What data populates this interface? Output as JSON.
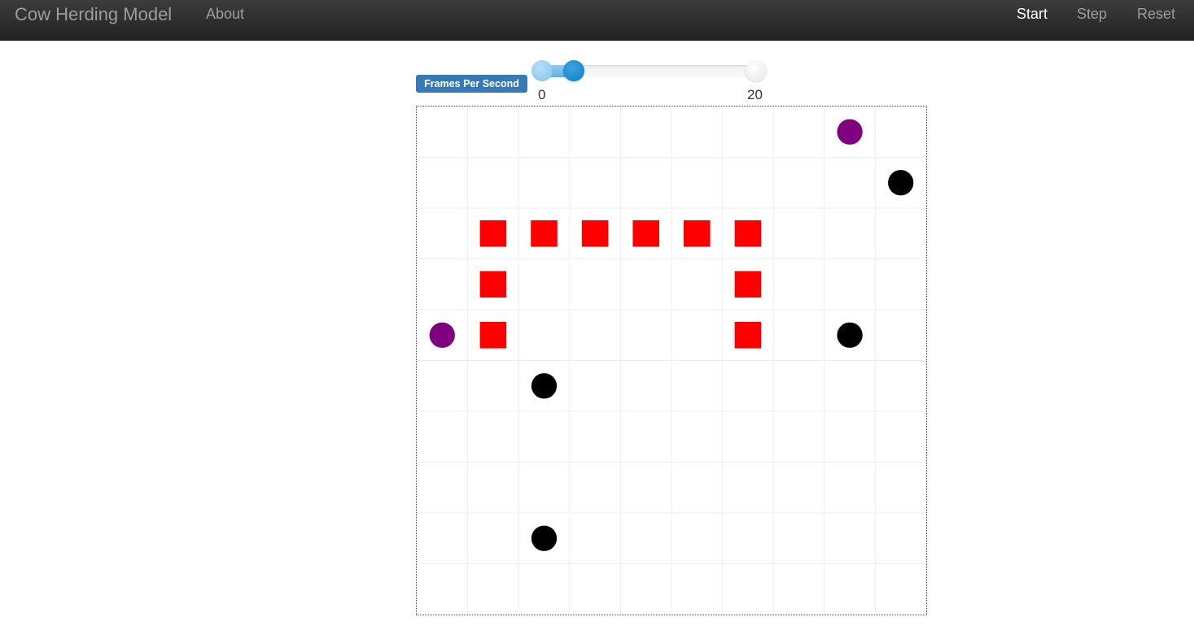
{
  "navbar": {
    "brand": "Cow Herding Model",
    "about": "About",
    "start": "Start",
    "step": "Step",
    "reset": "Reset"
  },
  "controls": {
    "fps_label": "Frames Per Second",
    "slider": {
      "min_label": "0",
      "max_label": "20",
      "min": 0,
      "max": 20,
      "value": 3
    }
  },
  "grid": {
    "columns": 10,
    "rows": 10,
    "colors": {
      "cow": "#000000",
      "herder": "#800080",
      "fence": "#ff0000",
      "gridline": "#eeeeee"
    },
    "agents": [
      {
        "type": "herder",
        "col": 8,
        "row": 0
      },
      {
        "type": "cow",
        "col": 9,
        "row": 1
      },
      {
        "type": "fence",
        "col": 1,
        "row": 2
      },
      {
        "type": "fence",
        "col": 2,
        "row": 2
      },
      {
        "type": "fence",
        "col": 3,
        "row": 2
      },
      {
        "type": "fence",
        "col": 4,
        "row": 2
      },
      {
        "type": "fence",
        "col": 5,
        "row": 2
      },
      {
        "type": "fence",
        "col": 6,
        "row": 2
      },
      {
        "type": "fence",
        "col": 1,
        "row": 3
      },
      {
        "type": "fence",
        "col": 6,
        "row": 3
      },
      {
        "type": "herder",
        "col": 0,
        "row": 4
      },
      {
        "type": "fence",
        "col": 1,
        "row": 4
      },
      {
        "type": "fence",
        "col": 6,
        "row": 4
      },
      {
        "type": "cow",
        "col": 8,
        "row": 4
      },
      {
        "type": "cow",
        "col": 2,
        "row": 5
      },
      {
        "type": "cow",
        "col": 2,
        "row": 8
      }
    ]
  }
}
